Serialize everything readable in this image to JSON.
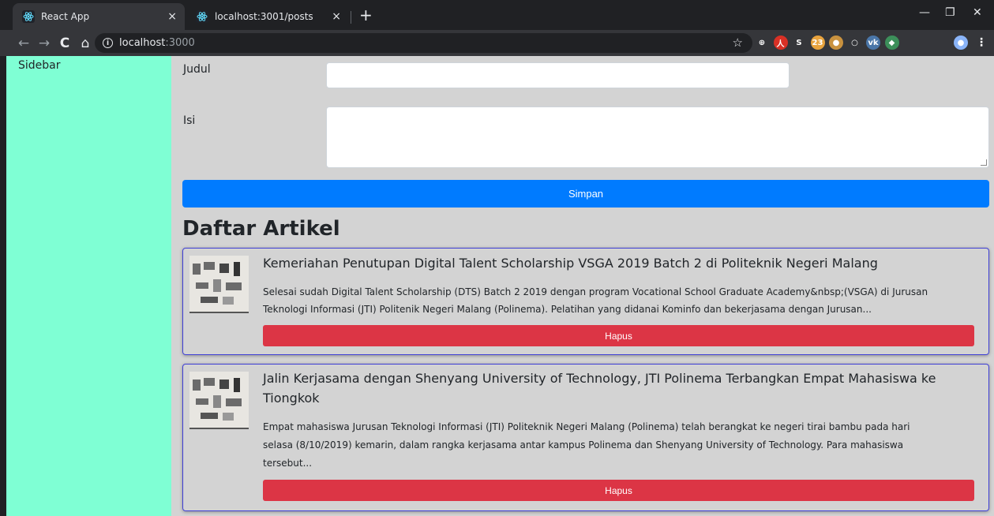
{
  "browser": {
    "tabs": [
      {
        "title": "React App",
        "close": "×",
        "active": true
      },
      {
        "title": "localhost:3001/posts",
        "close": "×",
        "active": false
      }
    ],
    "new_tab": "+",
    "window_controls": {
      "minimize": "—",
      "restore": "❐",
      "close": "✕"
    },
    "nav": {
      "back": "←",
      "forward": "→",
      "reload": "C",
      "home": "⌂"
    },
    "url": {
      "host": "localhost",
      "port": ":3000"
    },
    "extensions": [
      {
        "name": "ext-icon-1",
        "label": "⊕",
        "color": "#35363a"
      },
      {
        "name": "ext-icon-2",
        "label": "人",
        "color": "#d93025"
      },
      {
        "name": "ext-icon-3",
        "label": "S",
        "color": "#35363a"
      },
      {
        "name": "ext-icon-4",
        "label": "23",
        "color": "#e8a33d"
      },
      {
        "name": "ext-icon-5",
        "label": "●",
        "color": "#c9923f"
      },
      {
        "name": "ext-icon-6",
        "label": "○",
        "color": "#35363a"
      },
      {
        "name": "ext-icon-7",
        "label": "vk",
        "color": "#4a76a8"
      },
      {
        "name": "ext-icon-8",
        "label": "◆",
        "color": "#3c8f5a"
      }
    ]
  },
  "sidebar": {
    "label": "Sidebar"
  },
  "form": {
    "judul_label": "Judul",
    "judul_value": "",
    "isi_label": "Isi",
    "isi_value": "",
    "submit_label": "Simpan"
  },
  "list": {
    "title": "Daftar Artikel",
    "articles": [
      {
        "title": "Kemeriahan Penutupan Digital Talent Scholarship VSGA 2019 Batch 2 di Politeknik Negeri Malang",
        "body_line1": "Selesai sudah Digital Talent Scholarship (DTS) Batch 2 2019 dengan program Vocational School Graduate Academy&nbsp;(VSGA) di Jurusan",
        "body_line2": "Teknologi Informasi (JTI) Politenik Negeri Malang (Polinema). Pelatihan yang didanai Kominfo dan bekerjasama dengan Jurusan...",
        "delete_label": "Hapus"
      },
      {
        "title_line1": "Jalin Kerjasama dengan Shenyang University of Technology, JTI Polinema Terbangkan Empat Mahasiswa ke",
        "title_line2": "Tiongkok",
        "body_line1": "Empat mahasiswa Jurusan Teknologi Informasi (JTI) Politeknik Negeri Malang (Polinema) telah berangkat ke negeri tirai bambu pada hari",
        "body_line2": "selasa (8/10/2019) kemarin, dalam rangka kerjasama antar kampus Polinema dan Shenyang University of Technology. Para mahasiswa",
        "body_line3": "tersebut...",
        "delete_label": "Hapus"
      }
    ]
  },
  "colors": {
    "sidebar_bg": "#7fffd4",
    "content_bg": "#d3d3d3",
    "primary": "#007bff",
    "danger": "#dc3545",
    "card_border": "#3f3fd6"
  }
}
